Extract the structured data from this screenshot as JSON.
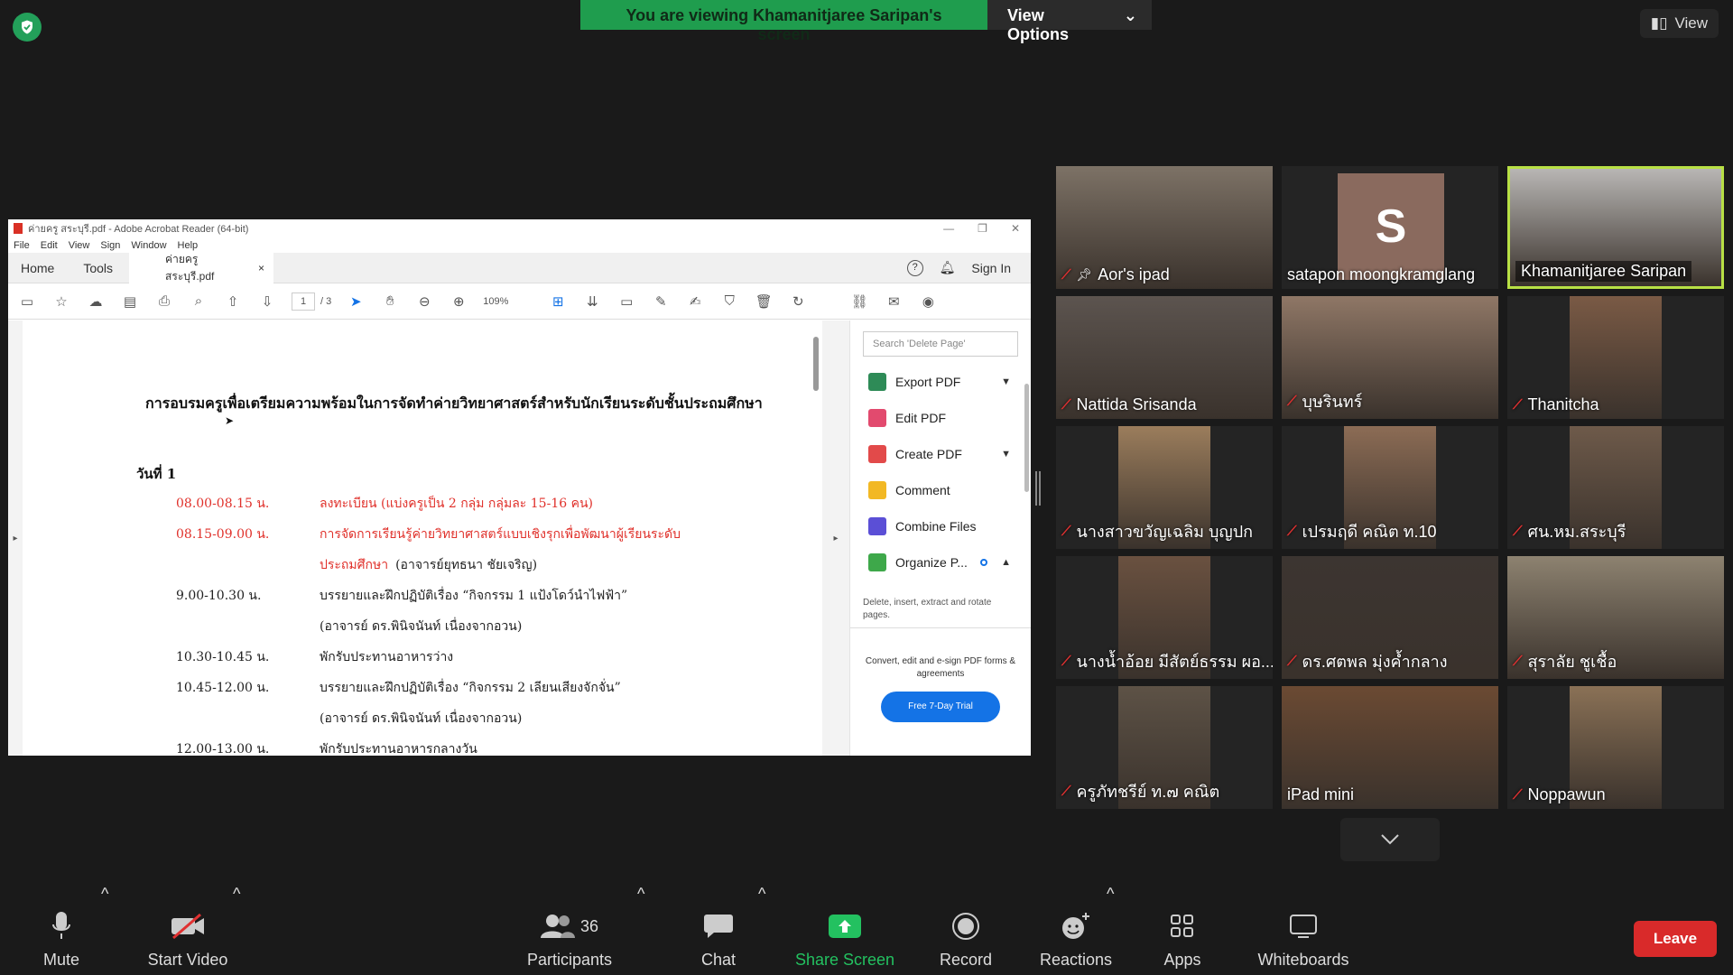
{
  "meeting": {
    "banner_text": "You are viewing Khamanitjaree Saripan's screen",
    "view_options_label": "View Options",
    "view_label": "View"
  },
  "acrobat": {
    "window_title": "ค่ายครู สระบุรี.pdf - Adobe Acrobat Reader (64-bit)",
    "menu": [
      "File",
      "Edit",
      "View",
      "Sign",
      "Window",
      "Help"
    ],
    "home_tab": "Home",
    "tools_tab": "Tools",
    "doc_tab": "ค่ายครู สระบุรี.pdf",
    "sign_in": "Sign In",
    "page_current": "1",
    "page_total": "/ 3",
    "zoom": "109%",
    "search_placeholder": "Search 'Delete Page'",
    "tools": [
      {
        "label": "Export PDF",
        "color": "#2e8b57"
      },
      {
        "label": "Edit PDF",
        "color": "#e24a6e"
      },
      {
        "label": "Create PDF",
        "color": "#e24a4a"
      },
      {
        "label": "Comment",
        "color": "#f2b824"
      },
      {
        "label": "Combine Files",
        "color": "#5b4fd6"
      },
      {
        "label": "Organize P...",
        "color": "#3ea84a"
      }
    ],
    "tool_desc": "Delete, insert, extract and rotate pages.",
    "convert_text": "Convert, edit and e-sign PDF forms & agreements",
    "trial_button": "Free 7-Day Trial",
    "document": {
      "title": "การอบรมครูเพื่อเตรียมความพร้อมในการจัดทำค่ายวิทยาศาสตร์สำหรับนักเรียนระดับชั้นประถมศึกษา",
      "day": "วันที่ 1",
      "rows": [
        {
          "time": "08.00-08.15 น.",
          "desc": "ลงทะเบียน (แบ่งครูเป็น 2 กลุ่ม กลุ่มละ 15-16 คน)",
          "red": true
        },
        {
          "time": "08.15-09.00 น.",
          "desc": "การจัดการเรียนรู้ค่ายวิทยาศาสตร์แบบเชิงรุกเพื่อพัฒนาผู้เรียนระดับ",
          "red": true
        },
        {
          "time": "",
          "desc": "ประถมศึกษา",
          "note": "(อาจารย์ยุทธนา ชัยเจริญ)",
          "red": true
        },
        {
          "time": "9.00-10.30 น.",
          "desc": "บรรยายและฝึกปฏิบัติเรื่อง “กิจกรรม 1 แป้งโดว์นำไฟฟ้า”",
          "red": false
        },
        {
          "time": "",
          "desc": "(อาจารย์ ดร.พินิจนันท์ เนื่องจากอวน)",
          "red": false
        },
        {
          "time": "10.30-10.45 น.",
          "desc": "พักรับประทานอาหารว่าง",
          "red": false
        },
        {
          "time": "10.45-12.00 น.",
          "desc": "บรรยายและฝึกปฏิบัติเรื่อง “กิจกรรม 2 เลียนเสียงจักจั่น”",
          "red": false
        },
        {
          "time": "",
          "desc": "(อาจารย์ ดร.พินิจนันท์ เนื่องจากอวน)",
          "red": false
        },
        {
          "time": "12.00-13.00 น.",
          "desc": "พักรับประทานอาหารกลางวัน",
          "red": false
        }
      ]
    }
  },
  "participants": [
    {
      "name": "Aor's ipad",
      "muted": true,
      "pinned": true,
      "bg": "#7d7266"
    },
    {
      "name": "satapon moongkramglang",
      "muted": false,
      "avatar": "S",
      "bg": "#242424"
    },
    {
      "name": "Khamanitjaree Saripan",
      "muted": false,
      "active": true,
      "bg": "#b8b6b4"
    },
    {
      "name": "Nattida Srisanda",
      "muted": true,
      "bg": "#5c544f"
    },
    {
      "name": "บุษรินทร์",
      "muted": true,
      "bg": "#8f7766"
    },
    {
      "name": "Thanitcha",
      "muted": true,
      "bg": "#7a5a45"
    },
    {
      "name": "นางสาวขวัญเฉลิม บุญปก",
      "muted": true,
      "bg": "#9b7d5c"
    },
    {
      "name": "เปรมฤดี คณิต ท.10",
      "muted": true,
      "bg": "#8c6c55"
    },
    {
      "name": "ศน.หม.สระบุรี",
      "muted": true,
      "bg": "#6e5a4a"
    },
    {
      "name": "นางน้ำอ้อย มีสัตย์ธรรม ผอ....",
      "muted": true,
      "bg": "#6a5140"
    },
    {
      "name": "ดร.ศตพล มุ่งค้ำกลาง",
      "muted": true,
      "bg": "#3c3531"
    },
    {
      "name": "สุราลัย ชูเชื้อ",
      "muted": true,
      "bg": "#8d8270"
    },
    {
      "name": "ครูภัทชรีย์ ท.๗ คณิต",
      "muted": true,
      "bg": "#5d5246"
    },
    {
      "name": "iPad mini",
      "muted": false,
      "bg": "#6b4a33"
    },
    {
      "name": "Noppawun",
      "muted": true,
      "bg": "#8a7156"
    }
  ],
  "toolbar": {
    "mute": "Mute",
    "start_video": "Start Video",
    "participants": "Participants",
    "participants_count": "36",
    "chat": "Chat",
    "share_screen": "Share Screen",
    "record": "Record",
    "reactions": "Reactions",
    "apps": "Apps",
    "whiteboards": "Whiteboards",
    "leave": "Leave"
  }
}
